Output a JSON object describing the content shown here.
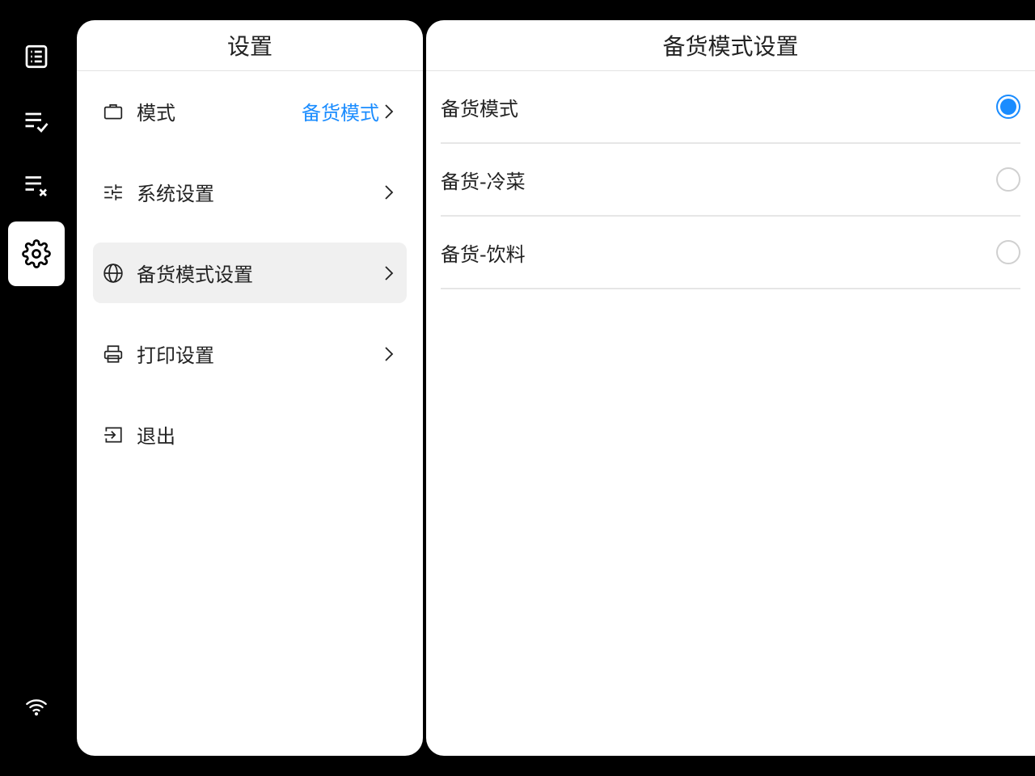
{
  "sidebar": {
    "items": [
      {
        "icon": "list-icon"
      },
      {
        "icon": "list-check-icon"
      },
      {
        "icon": "list-x-icon"
      },
      {
        "icon": "gear-icon",
        "active": true
      }
    ],
    "status_icon": "wifi-icon"
  },
  "settings": {
    "title": "设置",
    "menu": [
      {
        "icon": "briefcase-icon",
        "label": "模式",
        "value": "备货模式"
      },
      {
        "icon": "sliders-icon",
        "label": "系统设置",
        "value": ""
      },
      {
        "icon": "globe-icon",
        "label": "备货模式设置",
        "value": "",
        "active": true
      },
      {
        "icon": "printer-icon",
        "label": "打印设置",
        "value": ""
      },
      {
        "icon": "logout-icon",
        "label": "退出",
        "value": ""
      }
    ]
  },
  "stock_mode": {
    "title": "备货模式设置",
    "options": [
      {
        "label": "备货模式",
        "checked": true
      },
      {
        "label": "备货-冷菜",
        "checked": false
      },
      {
        "label": "备货-饮料",
        "checked": false
      }
    ]
  },
  "colors": {
    "accent": "#1a8cff",
    "background": "#000000",
    "panel": "#ffffff",
    "active_item": "#f0f0f0"
  }
}
